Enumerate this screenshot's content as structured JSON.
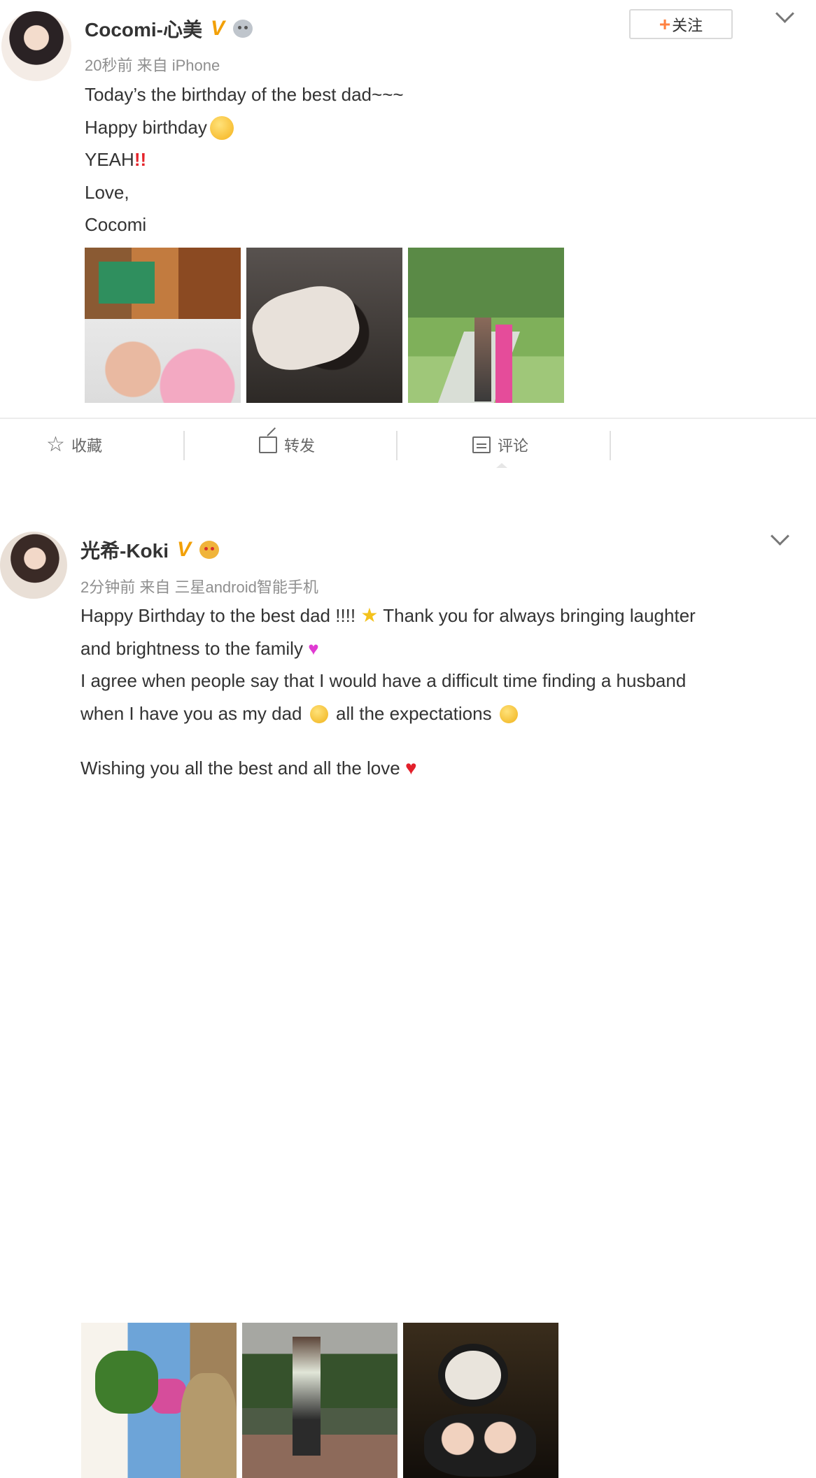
{
  "post1": {
    "author": "Cocomi-心美",
    "verified": "V",
    "meta": "20秒前 来自 iPhone",
    "follow_plus": "+",
    "follow_label": "关注",
    "lines": [
      "Today’s the birthday of the best dad~~~",
      "Happy birthday",
      "YEAH",
      "Love,",
      "Cocomi"
    ],
    "yeah_marks": "!!",
    "actions": {
      "favorite": "收藏",
      "repost": "转发",
      "comment": "评论"
    },
    "icons": [
      "star-outline-icon",
      "repost-icon",
      "comment-icon",
      "chevron-down-icon"
    ]
  },
  "post2": {
    "author": "光希-Koki",
    "verified": "V",
    "meta": "2分钟前 来自 三星android智能手机",
    "line1_a": "Happy Birthday to the best dad !!!!",
    "line1_b": "Thank you for always bringing laughter",
    "line2": "and brightness to the family",
    "line3": "I agree when people say that I would have a difficult time finding a husband",
    "line4_a": "when I have you as my dad",
    "line4_b": "all the expectations",
    "line5": "Wishing you all the best and all the love",
    "icons": [
      "star-emoji-icon",
      "pink-heart-icon",
      "red-heart-icon",
      "chevron-down-icon"
    ]
  },
  "colors": {
    "accent_orange": "#ff8140",
    "verified_gold": "#f2a007",
    "text": "#333333",
    "meta": "#8f8f8f"
  }
}
